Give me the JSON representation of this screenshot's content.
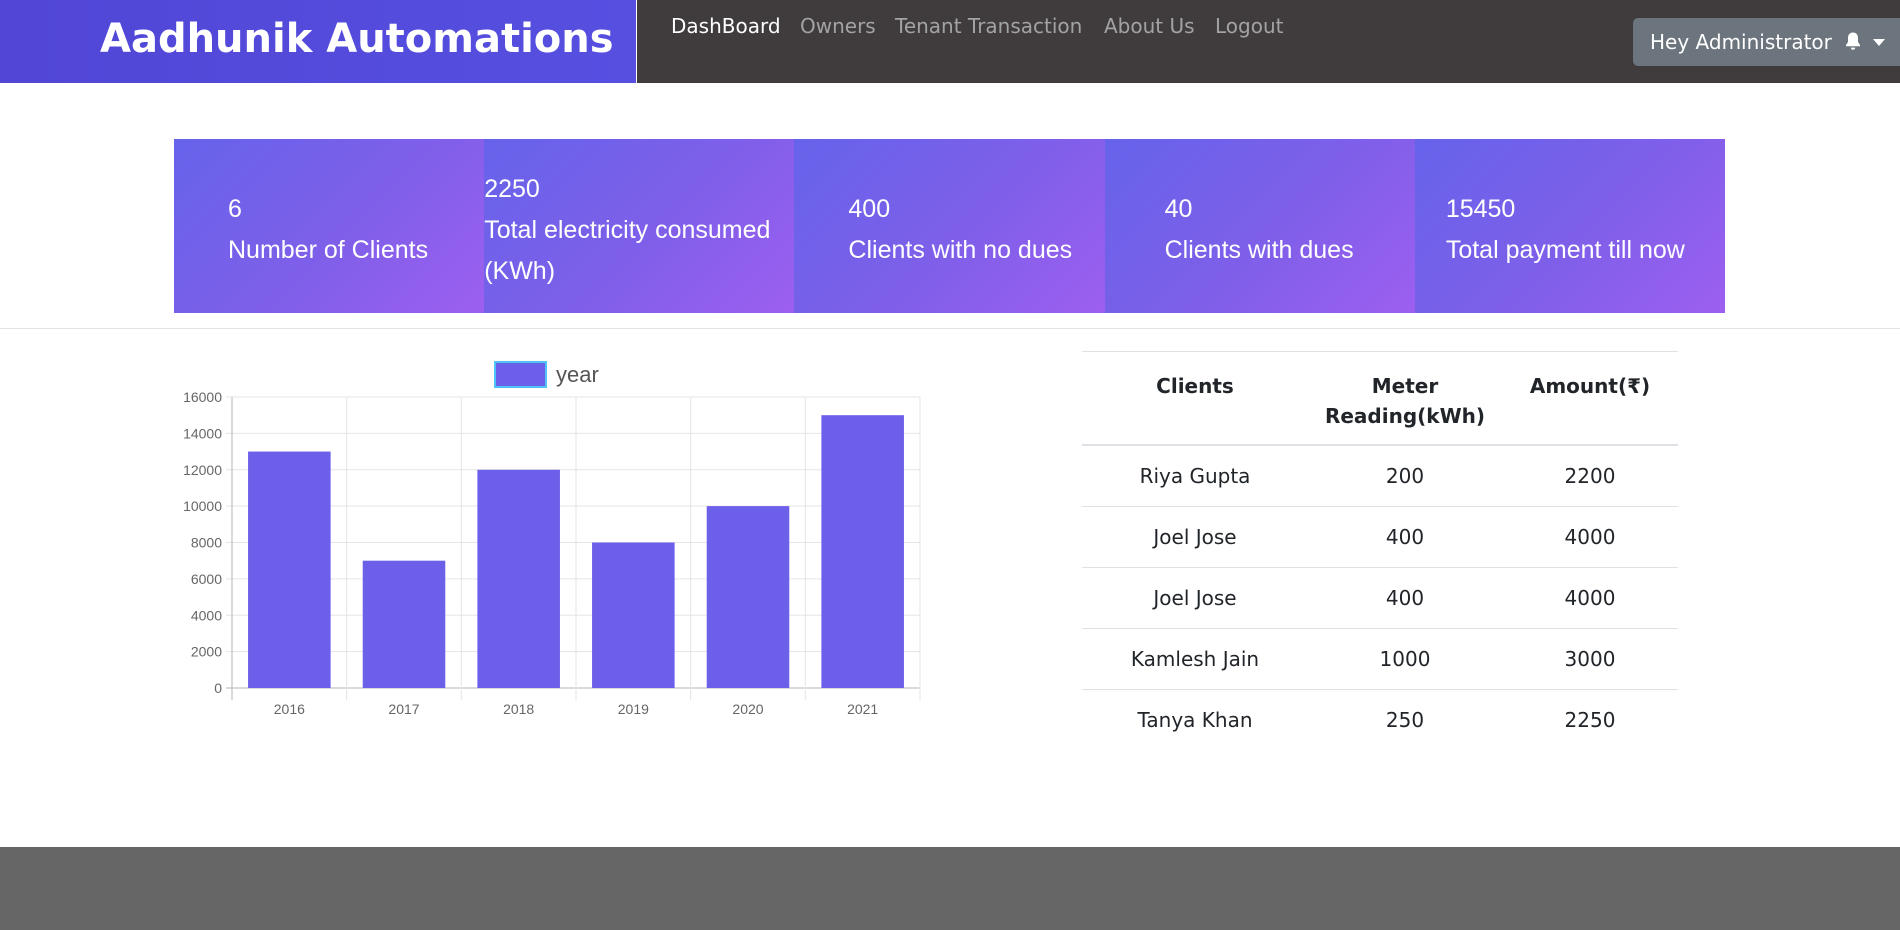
{
  "brand": {
    "title": "Aadhunik Automations"
  },
  "nav": {
    "items": [
      {
        "label": "DashBoard",
        "active": true
      },
      {
        "label": "Owners",
        "active": false
      },
      {
        "label": "Tenant Transaction",
        "active": false
      },
      {
        "label": "About Us",
        "active": false
      },
      {
        "label": "Logout",
        "active": false
      }
    ],
    "user_label": "Hey Administrator",
    "user_icon": "bell-icon",
    "dropdown_icon": "caret-down-icon"
  },
  "stats": [
    {
      "value": "6",
      "label": "Number of Clients"
    },
    {
      "value": "2250",
      "label": "Total electricity consumed",
      "label2": "(KWh)"
    },
    {
      "value": "400",
      "label": "Clients with no dues"
    },
    {
      "value": "40",
      "label": "Clients with dues"
    },
    {
      "value": "15450",
      "label": "Total payment till now"
    }
  ],
  "chart_data": {
    "type": "bar",
    "categories": [
      "2016",
      "2017",
      "2018",
      "2019",
      "2020",
      "2021"
    ],
    "series": [
      {
        "name": "year",
        "values": [
          13000,
          7000,
          12000,
          8000,
          10000,
          15000
        ]
      }
    ],
    "ylim": [
      0,
      16000
    ],
    "yticks": [
      0,
      2000,
      4000,
      6000,
      8000,
      10000,
      12000,
      14000,
      16000
    ],
    "grid": true,
    "legend": "top",
    "bar_color": "#6c5fe9",
    "legend_border_color": "#4fc3f7"
  },
  "table": {
    "headers": [
      "Clients",
      "Meter Reading(kWh)",
      "Amount(₹)"
    ],
    "rows": [
      [
        "Riya Gupta",
        "200",
        "2200"
      ],
      [
        "Joel Jose",
        "400",
        "4000"
      ],
      [
        "Joel Jose",
        "400",
        "4000"
      ],
      [
        "Kamlesh Jain",
        "1000",
        "3000"
      ],
      [
        "Tanya Khan",
        "250",
        "2250"
      ]
    ]
  },
  "colors": {
    "brand_bg": "#5146d6",
    "navbar_bg": "#403c3d",
    "card_gradient_start": "#6663ea",
    "card_gradient_end": "#9d5ff0",
    "footer_bg": "#666666"
  }
}
